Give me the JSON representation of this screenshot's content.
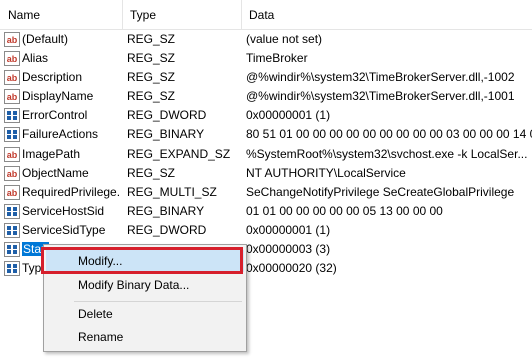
{
  "columns": {
    "name": "Name",
    "type": "Type",
    "data": "Data"
  },
  "rows": [
    {
      "icon": "string-value-icon",
      "name": "(Default)",
      "type": "REG_SZ",
      "data": "(value not set)"
    },
    {
      "icon": "string-value-icon",
      "name": "Alias",
      "type": "REG_SZ",
      "data": "TimeBroker"
    },
    {
      "icon": "string-value-icon",
      "name": "Description",
      "type": "REG_SZ",
      "data": "@%windir%\\system32\\TimeBrokerServer.dll,-1002"
    },
    {
      "icon": "string-value-icon",
      "name": "DisplayName",
      "type": "REG_SZ",
      "data": "@%windir%\\system32\\TimeBrokerServer.dll,-1001"
    },
    {
      "icon": "binary-value-icon",
      "name": "ErrorControl",
      "type": "REG_DWORD",
      "data": "0x00000001 (1)"
    },
    {
      "icon": "binary-value-icon",
      "name": "FailureActions",
      "type": "REG_BINARY",
      "data": "80 51 01 00 00 00 00 00 00 00 00 00 03 00 00 00 14 00..."
    },
    {
      "icon": "string-value-icon",
      "name": "ImagePath",
      "type": "REG_EXPAND_SZ",
      "data": "%SystemRoot%\\system32\\svchost.exe -k LocalSer..."
    },
    {
      "icon": "string-value-icon",
      "name": "ObjectName",
      "type": "REG_SZ",
      "data": "NT AUTHORITY\\LocalService"
    },
    {
      "icon": "string-value-icon",
      "name": "RequiredPrivilege...",
      "type": "REG_MULTI_SZ",
      "data": "SeChangeNotifyPrivilege SeCreateGlobalPrivilege"
    },
    {
      "icon": "binary-value-icon",
      "name": "ServiceHostSid",
      "type": "REG_BINARY",
      "data": "01 01 00 00 00 00 00 05 13 00 00 00"
    },
    {
      "icon": "binary-value-icon",
      "name": "ServiceSidType",
      "type": "REG_DWORD",
      "data": "0x00000001 (1)"
    },
    {
      "icon": "binary-value-icon",
      "name": "Start",
      "type": "REG_DWORD",
      "data": "0x00000003 (3)",
      "selected": true
    },
    {
      "icon": "binary-value-icon",
      "name": "Type",
      "type": "REG_DWORD",
      "data": "0x00000020 (32)"
    }
  ],
  "context_menu": {
    "modify": "Modify...",
    "modify_binary": "Modify Binary Data...",
    "delete": "Delete",
    "rename": "Rename"
  },
  "colors": {
    "selection": "#0078d7",
    "menu_hover": "#cce4f7",
    "annotation_box": "#d61f2c",
    "string_icon": "#c0392b",
    "binary_icon": "#1f5fa8"
  }
}
